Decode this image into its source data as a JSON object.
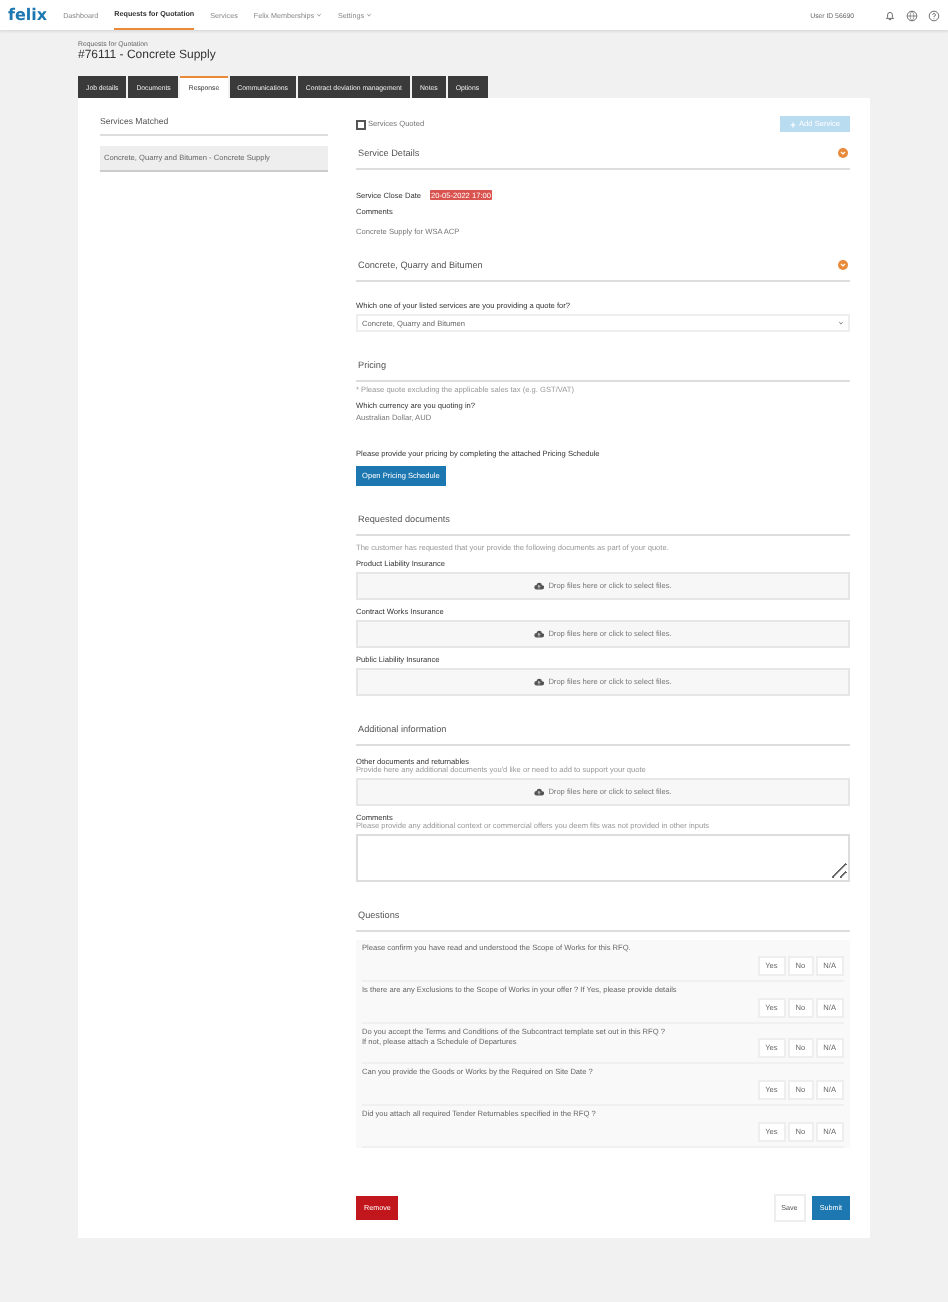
{
  "nav": {
    "logo": "felix",
    "items": [
      {
        "label": "Dashboard",
        "selected": false,
        "dropdown": false
      },
      {
        "label": "Requests for Quotation",
        "selected": true,
        "dropdown": false
      },
      {
        "label": "Services",
        "selected": false,
        "dropdown": false
      },
      {
        "label": "Felix Memberships",
        "selected": false,
        "dropdown": true
      },
      {
        "label": "Settings",
        "selected": false,
        "dropdown": true
      }
    ],
    "user": "User ID 56690"
  },
  "header": {
    "breadcrumb": "Requests for Quotation",
    "title": "#76111 - Concrete Supply"
  },
  "tabs": [
    {
      "label": "Job details",
      "selected": false
    },
    {
      "label": "Documents",
      "selected": false
    },
    {
      "label": "Response",
      "selected": true
    },
    {
      "label": "Communications",
      "selected": false
    },
    {
      "label": "Contract deviation management",
      "selected": false
    },
    {
      "label": "Notes",
      "selected": false
    },
    {
      "label": "Options",
      "selected": false
    }
  ],
  "services_matched": {
    "title": "Services Matched",
    "items": [
      {
        "label": "Concrete, Quarry and Bitumen - Concrete Supply",
        "selected": true
      }
    ]
  },
  "services_quoted": {
    "label": "Services Quoted",
    "checked": false,
    "add_button": "Add Service",
    "add_disabled": true
  },
  "service_details": {
    "title": "Service Details",
    "close_label": "Service Close Date",
    "close_date": "20-05-2022 17:00",
    "comments_label": "Comments",
    "comments": "Concrete Supply for WSA ACP"
  },
  "service": {
    "title": "Concrete, Quarry and Bitumen",
    "question": "Which one of your listed services are you providing a quote for?",
    "value": "Concrete, Quarry and Bitumen"
  },
  "pricing": {
    "title": "Pricing",
    "note": "* Please quote excluding the applicable sales tax (e.g. GST/VAT)",
    "currency_question": "Which currency are you quoting in?",
    "currency": "Australian Dollar, AUD",
    "prompt": "Please provide your pricing by completing the attached Pricing Schedule",
    "button": "Open Pricing Schedule"
  },
  "requested_documents": {
    "title": "Requested documents",
    "note": "The customer has requested that your provide the following documents as part of your quote.",
    "documents": [
      {
        "label": "Product Liability Insurance",
        "dropzone": "Drop files here or click to select files."
      },
      {
        "label": "Contract Works Insurance",
        "dropzone": "Drop files here or click to select files."
      },
      {
        "label": "Public Liability Insurance",
        "dropzone": "Drop files here or click to select files."
      }
    ]
  },
  "additional_information": {
    "title": "Additional information",
    "other_label": "Other documents and returnables",
    "other_hint": "Provide here any additional documents you'd like or need to add to support your quote",
    "dropzone": "Drop files here or click to select files.",
    "comments_label": "Comments",
    "comments_hint": "Please provide any additional context or commercial offers you deem fits was not provided in other inputs"
  },
  "questions": {
    "title": "Questions",
    "items": [
      {
        "lines": [
          "Please confirm you have read and understood the Scope of Works for this RFQ."
        ],
        "options": [
          {
            "label": "Yes",
            "selected": false
          },
          {
            "label": "No",
            "selected": false
          },
          {
            "label": "N/A",
            "selected": false
          }
        ]
      },
      {
        "lines": [
          "Is there are any Exclusions to the Scope of Works in your offer ? If Yes, please provide details"
        ],
        "options": [
          {
            "label": "Yes",
            "selected": false
          },
          {
            "label": "No",
            "selected": false
          },
          {
            "label": "N/A",
            "selected": false
          }
        ]
      },
      {
        "lines": [
          "Do you accept the Terms and Conditions of the Subcontract template set out in this RFQ ?",
          "If not, please attach a Schedule of Departures"
        ],
        "options": [
          {
            "label": "Yes",
            "selected": false
          },
          {
            "label": "No",
            "selected": false
          },
          {
            "label": "N/A",
            "selected": false
          }
        ]
      },
      {
        "lines": [
          "Can you provide the Goods or Works by the Required on Site Date ?"
        ],
        "options": [
          {
            "label": "Yes",
            "selected": false
          },
          {
            "label": "No",
            "selected": false
          },
          {
            "label": "N/A",
            "selected": false
          }
        ]
      },
      {
        "lines": [
          "Did you attach all required Tender Returnables specified in the RFQ ?"
        ],
        "options": [
          {
            "label": "Yes",
            "selected": false
          },
          {
            "label": "No",
            "selected": false
          },
          {
            "label": "N/A",
            "selected": false
          }
        ]
      }
    ]
  },
  "actions": {
    "remove": "Remove",
    "save": "Save",
    "submit": "Submit"
  }
}
